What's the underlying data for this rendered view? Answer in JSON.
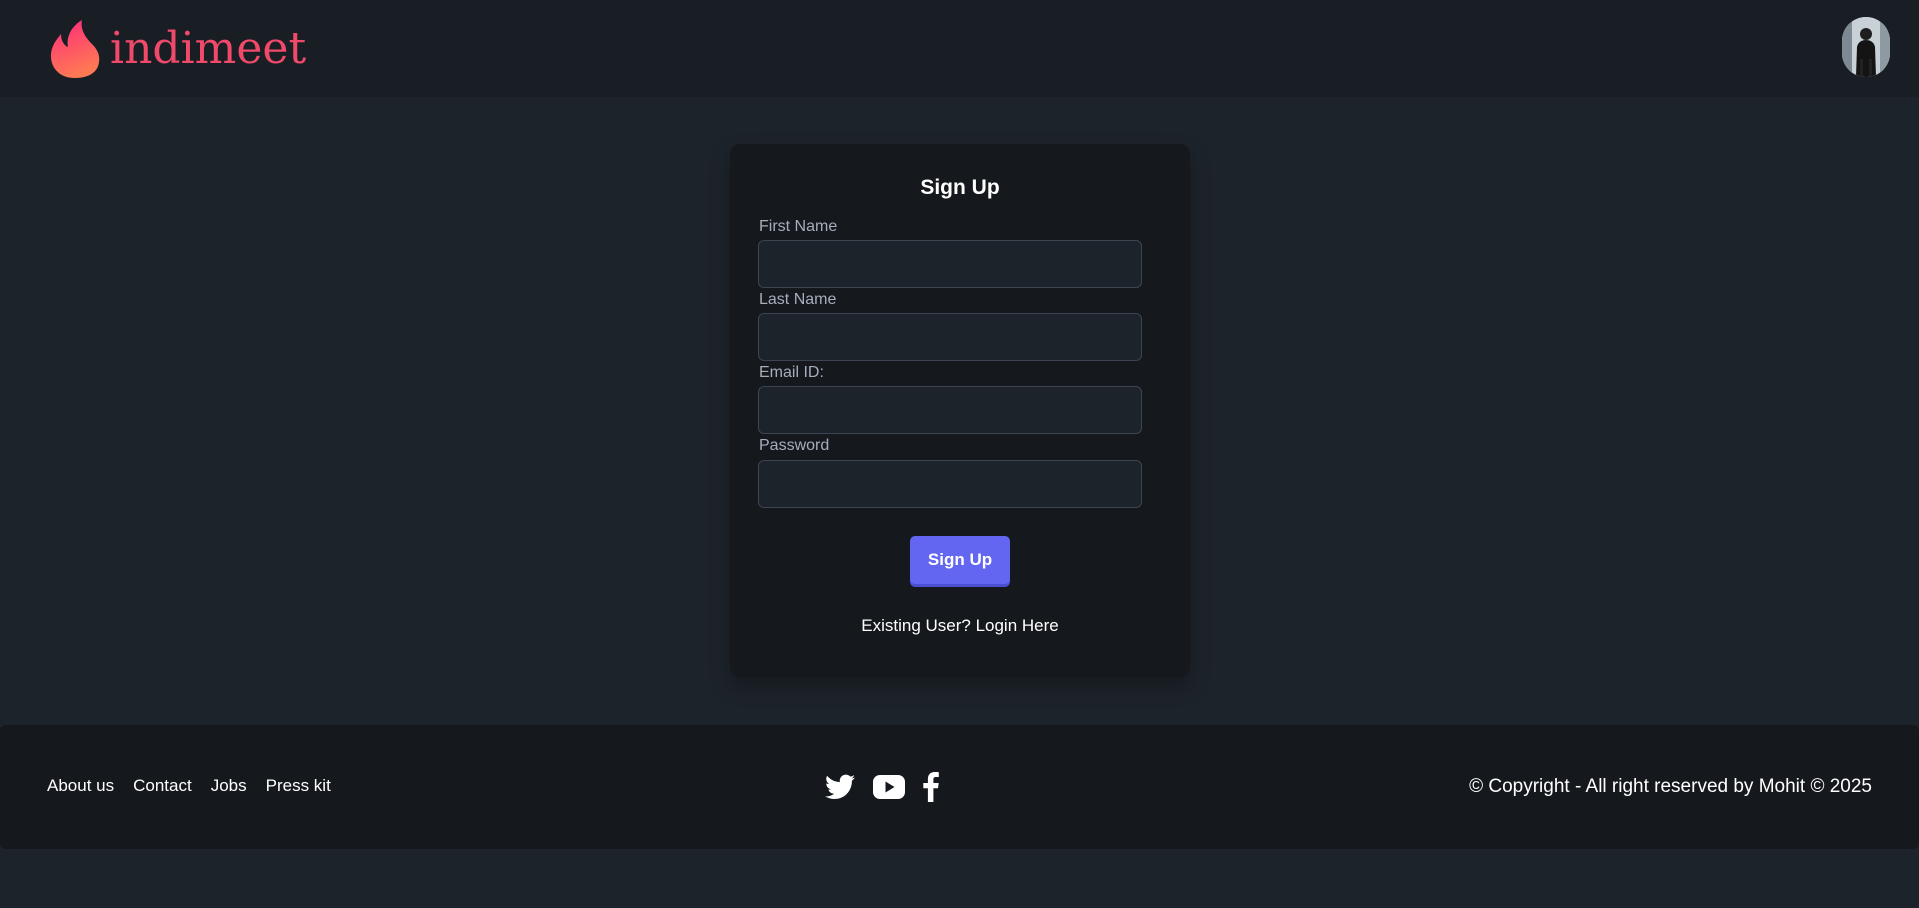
{
  "brand": {
    "name": "indimeet",
    "color": "#f0496a"
  },
  "header": {
    "avatar_alt": "user-avatar"
  },
  "signup": {
    "title": "Sign Up",
    "fields": [
      {
        "label": "First Name",
        "value": "",
        "placeholder": ""
      },
      {
        "label": "Last Name",
        "value": "",
        "placeholder": ""
      },
      {
        "label": "Email ID:",
        "value": "",
        "placeholder": ""
      },
      {
        "label": "Password",
        "value": "",
        "placeholder": ""
      }
    ],
    "submit_label": "Sign Up",
    "login_link": "Existing User? Login Here",
    "accent": "#6366f1"
  },
  "footer": {
    "links": [
      "About us",
      "Contact",
      "Jobs",
      "Press kit"
    ],
    "social_icons": [
      "twitter-icon",
      "youtube-icon",
      "facebook-icon"
    ],
    "copyright": "© Copyright - All right reserved by Mohit © 2025"
  }
}
